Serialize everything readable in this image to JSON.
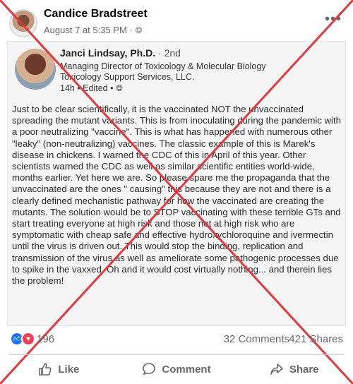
{
  "post": {
    "author": "Candice Bradstreet",
    "date": "August 7 at 5:35 PM",
    "privacy_icon": "globe-icon",
    "more_icon": "more-options-icon"
  },
  "embed": {
    "name": "Janci Lindsay, Ph.D.",
    "degree": "2nd",
    "title_line1": "Managing Director of Toxicology & Molecular Biology",
    "title_line2": "Toxicology Support Services, LLC.",
    "time": "14h • Edited •",
    "body": "Just to be clear scientifically, it is the vaccinated NOT the unvaccinated spreading the mutant variants. This is from inoculating during the pandemic with a poor neutralizing \"vaccine\". This is what has happened with numerous other \"leaky\" (non-neutralizing) vaccines. The classic example of this is Marek's disease in chickens. I warned the CDC of this in April of this year. Other scientists warned the CDC as well as similar scientific entities world-wide, months earlier. Yet here we are. So please spare me the propaganda that the unvaccinated are the ones \" causing\" this because they are not and there is a clearly defined mechanistic pathway for how the vaccinated are creating the mutants. The solution would be to STOP vaccinating with these terrible GTs and start treating everyone at high risk and those not at high risk who are symptomatic with cheap safe and effective hydroxychloroquine and ivermectin until the virus is driven out. This would stop the binding, replication and transmission of the virus as well as ameliorate some pathogenic processes due to spike in the vaxxed. Oh and it would cost virtually nothing... and therein lies the problem!"
  },
  "stats": {
    "reactions": "196",
    "comments": "32 Comments",
    "shares": "421 Shares"
  },
  "actions": {
    "like": "Like",
    "comment": "Comment",
    "share": "Share"
  },
  "colors": {
    "cross": "#e0393e",
    "like_blue": "#1877f2",
    "love_red": "#f33e58"
  }
}
